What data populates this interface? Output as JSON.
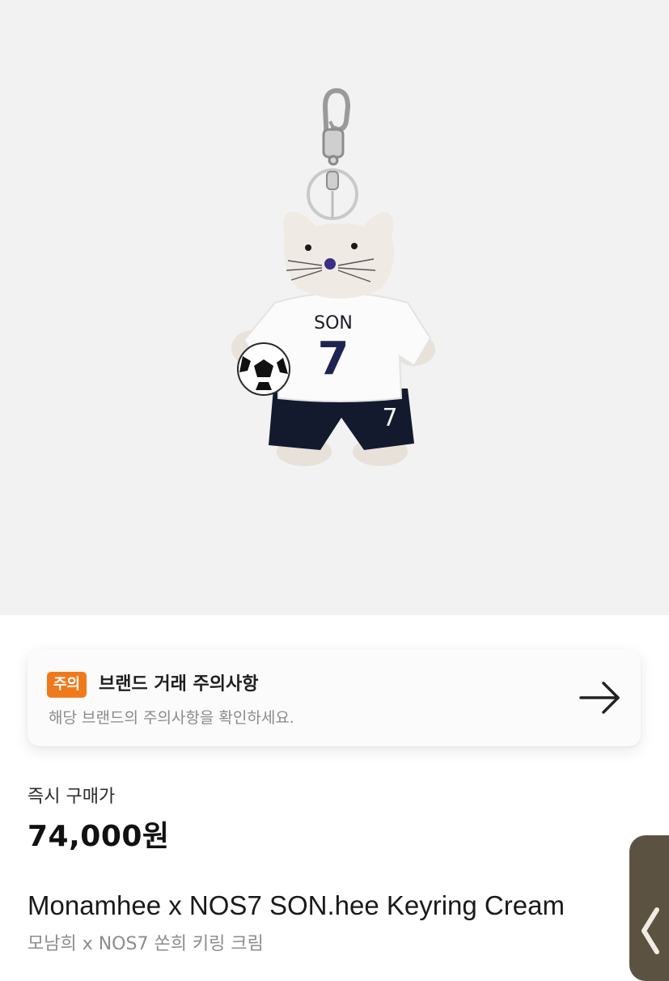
{
  "notice": {
    "badge": "주의",
    "title": "브랜드 거래 주의사항",
    "description": "해당 브랜드의 주의사항을 확인하세요."
  },
  "price": {
    "label": "즉시 구매가",
    "value": "74,000원"
  },
  "product": {
    "name_en": "Monamhee x NOS7 SON.hee Keyring Cream",
    "name_ko": "모남희 x NOS7 쏜희 키링 크림",
    "image_jersey_name": "SON",
    "image_jersey_number": "7"
  },
  "colors": {
    "badge": "#f07a1b",
    "hero_bg": "#f2f2f2",
    "side_tab": "#5b5242"
  },
  "icons": {
    "notice_arrow": "arrow-right-icon",
    "side_tab": "chevron-left-icon"
  }
}
